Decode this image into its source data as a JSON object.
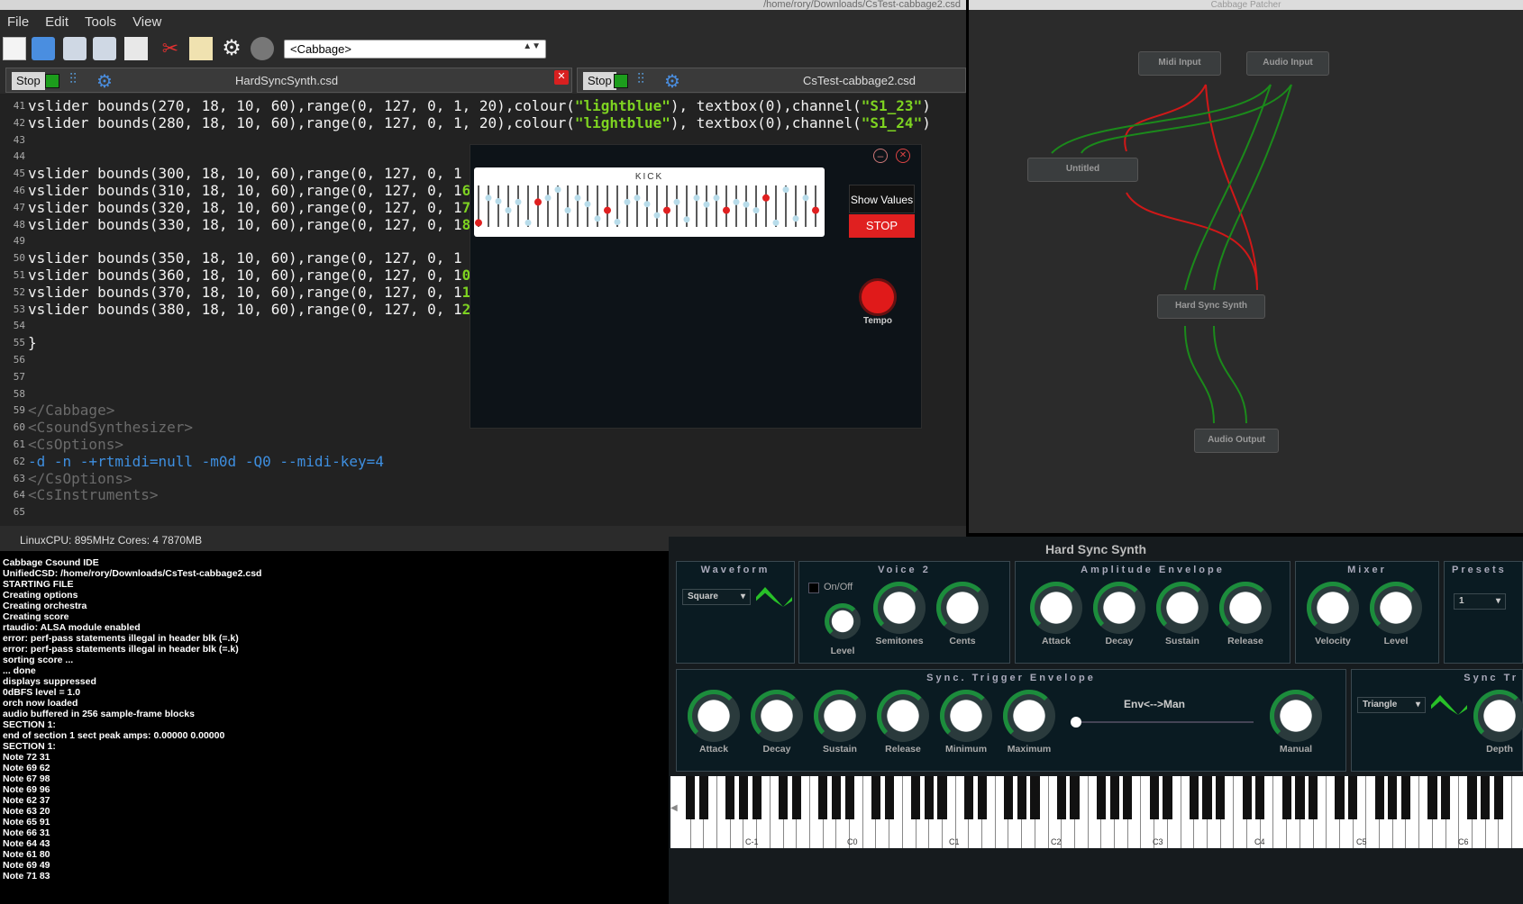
{
  "ide": {
    "path": "/home/rory/Downloads/CsTest-cabbage2.csd",
    "menu": [
      "File",
      "Edit",
      "Tools",
      "View"
    ],
    "combo_value": "<Cabbage>"
  },
  "tabs": [
    {
      "stop": "Stop",
      "name": "HardSyncSynth.csd"
    },
    {
      "stop": "Stop",
      "name": "CsTest-cabbage2.csd"
    }
  ],
  "editor": {
    "lines": [
      {
        "n": "41",
        "t": "vslider bounds(270, 18, 10, 60),range(0, 127, 0, 1, 20),colour(",
        "s": "\"lightblue\"",
        "u": "), textbox(0),channel(",
        "s2": "\"S1_23\"",
        "e": ")"
      },
      {
        "n": "42",
        "t": "vslider bounds(280, 18, 10, 60),range(0, 127, 0, 1, 20),colour(",
        "s": "\"lightblue\"",
        "u": "), textbox(0),channel(",
        "s2": "\"S1_24\"",
        "e": ")"
      },
      {
        "n": "43"
      },
      {
        "n": "44"
      },
      {
        "n": "45",
        "t": "vslider bounds(300, 18, 10, 60),range(0, 127, 0, 1"
      },
      {
        "n": "46",
        "t": "vslider bounds(310, 18, 10, 60),range(0, 127, 0, 1",
        "s": "6\"",
        "e": ")"
      },
      {
        "n": "47",
        "t": "vslider bounds(320, 18, 10, 60),range(0, 127, 0, 1",
        "s": "7\"",
        "e": ")"
      },
      {
        "n": "48",
        "t": "vslider bounds(330, 18, 10, 60),range(0, 127, 0, 1",
        "s": "8\"",
        "e": ")"
      },
      {
        "n": "49"
      },
      {
        "n": "50",
        "t": "vslider bounds(350, 18, 10, 60),range(0, 127, 0, 1"
      },
      {
        "n": "51",
        "t": "vslider bounds(360, 18, 10, 60),range(0, 127, 0, 1",
        "s": "0\"",
        "e": ")"
      },
      {
        "n": "52",
        "t": "vslider bounds(370, 18, 10, 60),range(0, 127, 0, 1",
        "s": "1\"",
        "e": ")"
      },
      {
        "n": "53",
        "t": "vslider bounds(380, 18, 10, 60),range(0, 127, 0, 1",
        "s": "2\"",
        "e": ")"
      },
      {
        "n": "54"
      },
      {
        "n": "55",
        "t": "}"
      },
      {
        "n": "56"
      },
      {
        "n": "57"
      },
      {
        "n": "58"
      },
      {
        "n": "59",
        "tag": "</Cabbage>"
      },
      {
        "n": "60",
        "tag": "<CsoundSynthesizer>"
      },
      {
        "n": "61",
        "tag": "<CsOptions>"
      },
      {
        "n": "62",
        "opt": true
      },
      {
        "n": "63",
        "tag": "</CsOptions>"
      },
      {
        "n": "64",
        "tag": "<CsInstruments>"
      },
      {
        "n": "65"
      }
    ]
  },
  "options_line": [
    "-d -n -+rtmidi=null -m0d -Q0 --midi-key=4"
  ],
  "status": "LinuxCPU: 895MHz  Cores: 4  7870MB",
  "console": [
    "Cabbage Csound IDE",
    "UnifiedCSD:  /home/rory/Downloads/CsTest-cabbage2.csd",
    "STARTING FILE",
    "Creating options",
    "Creating orchestra",
    "Creating score",
    "rtaudio: ALSA module enabled",
    "error:  perf-pass statements illegal in header blk (=.k)",
    "error:  perf-pass statements illegal in header blk (=.k)",
    "sorting score ...",
    "   ... done",
    "displays suppressed",
    "0dBFS level = 1.0",
    "orch now loaded",
    "audio buffered in 256 sample-frame blocks",
    "SECTION 1:",
    "end of section 1    sect peak amps:  0.00000  0.00000",
    "SECTION 1:",
    "Note 72  31",
    "Note 69  62",
    "Note 67  98",
    "Note 69  96",
    "Note 62  37",
    "Note 63  20",
    "Note 65  91",
    "Note 66  31",
    "Note 64  43",
    "Note 61  80",
    "Note 69  49",
    "Note 71  83"
  ],
  "patcher": {
    "title": "Cabbage Patcher",
    "nodes": {
      "midi": "Midi Input",
      "audio": "Audio Input",
      "untitled": "Untitled",
      "hss": "Hard Sync Synth",
      "out": "Audio Output"
    }
  },
  "popup": {
    "kick": "KICK",
    "show_values": "Show Values",
    "stop": "STOP",
    "tempo": "Tempo"
  },
  "synth": {
    "title": "Hard Sync Synth",
    "waveform": {
      "title": "Waveform",
      "value": "Square"
    },
    "voice2": {
      "title": "Voice 2",
      "onoff": "On/Off",
      "level": "Level",
      "semitones": "Semitones",
      "cents": "Cents"
    },
    "ampenv": {
      "title": "Amplitude Envelope",
      "attack": "Attack",
      "decay": "Decay",
      "sustain": "Sustain",
      "release": "Release"
    },
    "mixer": {
      "title": "Mixer",
      "velocity": "Velocity",
      "level": "Level"
    },
    "presets": {
      "title": "Presets",
      "value": "1"
    },
    "synctrig": {
      "title": "Sync. Trigger Envelope",
      "attack": "Attack",
      "decay": "Decay",
      "sustain": "Sustain",
      "release": "Release",
      "minimum": "Minimum",
      "maximum": "Maximum",
      "envman": "Env<-->Man",
      "manual": "Manual"
    },
    "sync2": {
      "title": "Sync Tr",
      "value": "Triangle",
      "depth": "Depth"
    },
    "keys": [
      "C-1",
      "C0",
      "C1",
      "C2",
      "C3",
      "C4",
      "C5",
      "C6"
    ]
  },
  "colors": {
    "green": "#1c9d1c",
    "red": "#e02020",
    "lightblue": "#b8dcea",
    "accent_arc": "#1c8d3c"
  }
}
